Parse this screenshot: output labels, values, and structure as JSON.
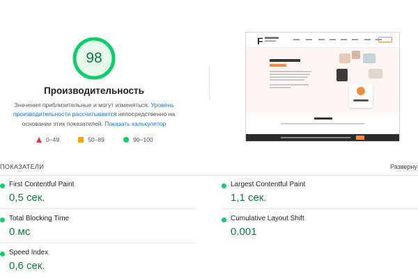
{
  "score": {
    "value": "98",
    "fraction": 0.98,
    "title": "Производительность",
    "color": "#0cce6b",
    "text_color": "#0a7e3c"
  },
  "description": {
    "part1": "Значения приблизительные и могут изменяться.",
    "link1": "Уровень производительности рассчитывается",
    "part2": "непосредственно на основании этих показателей.",
    "link2": "Показать калькулятор"
  },
  "legend": [
    {
      "icon": "triangle-fail-icon",
      "label": "0–49",
      "color": "#e53935"
    },
    {
      "icon": "square-average-icon",
      "label": "50–89",
      "color": "#ffa400"
    },
    {
      "icon": "circle-pass-icon",
      "label": "90–100",
      "color": "#0cce6b"
    }
  ],
  "metrics_section": {
    "header": "ПОКАЗАТЕЛИ",
    "expand_label": "Развернуть"
  },
  "metrics": [
    {
      "label": "First Contentful Paint",
      "value": "0,5 сек."
    },
    {
      "label": "Largest Contentful Paint",
      "value": "1,1 сек."
    },
    {
      "label": "Total Blocking Time",
      "value": "0 мс"
    },
    {
      "label": "Cumulative Layout Shift",
      "value": "0.001"
    },
    {
      "label": "Speed Index",
      "value": "0,6 сек."
    }
  ],
  "accent_link_color": "#1a73e8"
}
